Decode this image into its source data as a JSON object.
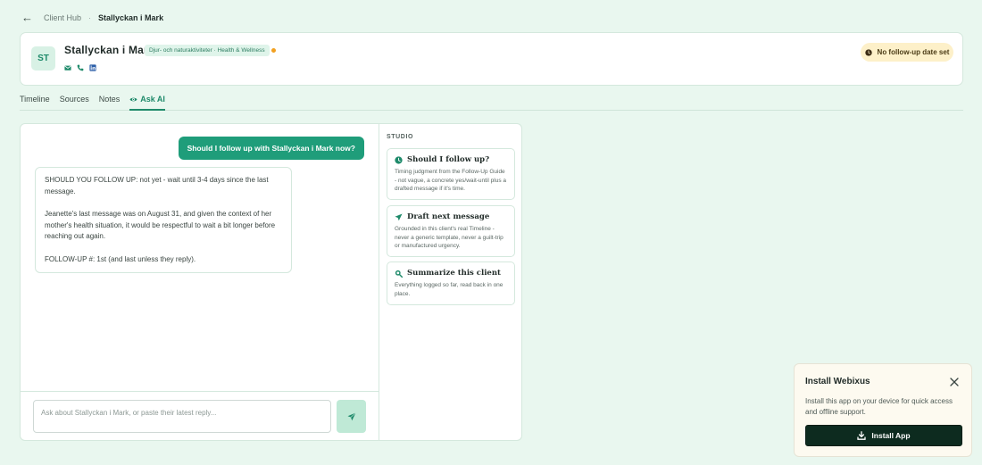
{
  "breadcrumb": {
    "parent": "Client Hub",
    "separator": "·",
    "current": "Stallyckan i Mark"
  },
  "client": {
    "initials": "ST",
    "name": "Stallyckan i Mark",
    "category": "Djur- och naturaktiviteter · Health & Wellness",
    "status_color": "#f2a020",
    "contact_icons": [
      "mail-icon",
      "phone-icon",
      "linkedin-icon"
    ]
  },
  "followup": {
    "label": "No follow-up date set",
    "icon": "clock-icon"
  },
  "tabs": [
    {
      "label": "Timeline",
      "active": false
    },
    {
      "label": "Sources",
      "active": false
    },
    {
      "label": "Notes",
      "active": false
    },
    {
      "label": "Ask AI",
      "active": true,
      "icon": "eye-icon"
    }
  ],
  "chat": {
    "user_message": "Should I follow up with Stallyckan i Mark now?",
    "ai_paragraphs": [
      "SHOULD YOU FOLLOW UP: not yet - wait until 3-4 days since the last message.",
      "Jeanette's last message was on August 31, and given the context of her mother's health situation, it would be respectful to wait a bit longer before reaching out again.",
      "FOLLOW-UP #: 1st (and last unless they reply)."
    ],
    "input_placeholder": "Ask about Stallyckan i Mark, or paste their latest reply...",
    "send_icon": "send-icon"
  },
  "studio": {
    "label": "STUDIO",
    "cards": [
      {
        "icon": "clock-icon",
        "title": "Should I follow up?",
        "desc": "Timing judgment from the Follow-Up Guide - not vague, a concrete yes/wait-until plus a drafted message if it's time."
      },
      {
        "icon": "send-icon",
        "title": "Draft next message",
        "desc": "Grounded in this client's real Timeline - never a generic template, never a guilt-trip or manufactured urgency."
      },
      {
        "icon": "search-icon",
        "title": "Summarize this client",
        "desc": "Everything logged so far, read back in one place."
      }
    ]
  },
  "install": {
    "title": "Install Webixus",
    "desc": "Install this app on your device for quick access and offline support.",
    "button": "Install App"
  },
  "colors": {
    "accent": "#1f9d7a",
    "background": "#e9f7ef",
    "install_button": "#0d2b1f"
  }
}
